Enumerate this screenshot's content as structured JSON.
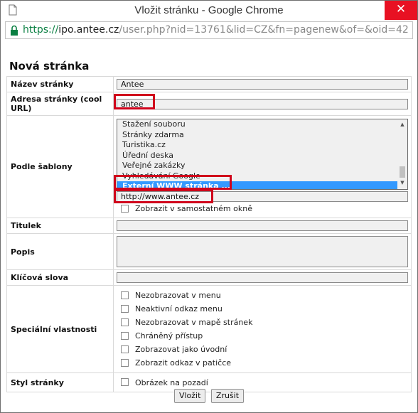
{
  "window": {
    "title": "Vložit stránku - Google Chrome",
    "close_glyph": "✕"
  },
  "address": {
    "scheme": "https://",
    "host": "ipo.antee.cz",
    "path": "/user.php?nid=13761&lid=CZ&fn=pagenew&of=&oid=42"
  },
  "page": {
    "title": "Nová stránka"
  },
  "form": {
    "name_label": "Název stránky",
    "name_value": "Antee",
    "url_label": "Adresa stránky (cool URL)",
    "url_value": "antee",
    "template_label": "Podle šablony",
    "template_options": [
      "Stažení souboru",
      "Stránky zdarma",
      "Turistika.cz",
      "Úřední deska",
      "Veřejné zakázky",
      "Vyhledávání Google",
      "Externí WWW stránka ..."
    ],
    "template_selected_index": 6,
    "external_url_value": "http://www.antee.cz",
    "new_window_label": "Zobrazit v samostatném okně",
    "titulek_label": "Titulek",
    "titulek_value": "",
    "popis_label": "Popis",
    "popis_value": "",
    "keywords_label": "Klíčová slova",
    "keywords_value": "",
    "special_label": "Speciální vlastnosti",
    "special_options": [
      "Nezobrazovat v menu",
      "Neaktivní odkaz menu",
      "Nezobrazovat v mapě stránek",
      "Chráněný přístup",
      "Zobrazovat jako úvodní",
      "Zobrazit odkaz v patičce"
    ],
    "style_label": "Styl stránky",
    "style_option": "Obrázek na pozadí"
  },
  "buttons": {
    "insert": "Vložit",
    "cancel": "Zrušit"
  },
  "colors": {
    "highlight": "#d0021b",
    "selected_option": "#3399ff",
    "close_button": "#e81123",
    "secure_scheme": "#0b8043"
  }
}
